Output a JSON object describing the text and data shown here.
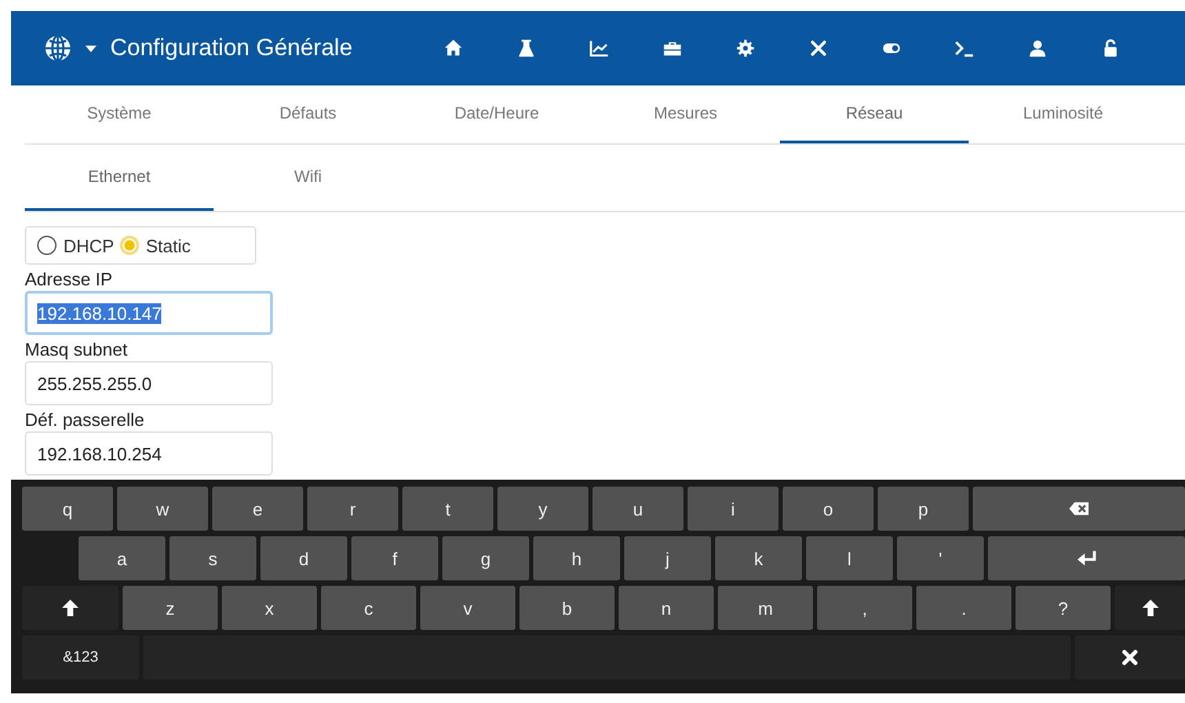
{
  "header": {
    "title": "Configuration Générale"
  },
  "tabs": [
    {
      "label": "Système",
      "selected": false
    },
    {
      "label": "Défauts",
      "selected": false
    },
    {
      "label": "Date/Heure",
      "selected": false
    },
    {
      "label": "Mesures",
      "selected": false
    },
    {
      "label": "Réseau",
      "selected": true
    },
    {
      "label": "Luminosité",
      "selected": false
    }
  ],
  "subtabs": [
    {
      "label": "Ethernet",
      "selected": true
    },
    {
      "label": "Wifi",
      "selected": false
    }
  ],
  "mode": [
    {
      "label": "DHCP",
      "selected": false
    },
    {
      "label": "Static",
      "selected": true
    }
  ],
  "fields": [
    {
      "label": "Adresse IP",
      "value": "192.168.10.147",
      "focused": true
    },
    {
      "label": "Masq subnet",
      "value": "255.255.255.0",
      "focused": false
    },
    {
      "label": "Déf. passerelle",
      "value": "192.168.10.254",
      "focused": false
    }
  ],
  "keyboard": [
    [
      {
        "kind": "char",
        "label": "q"
      },
      {
        "kind": "char",
        "label": "w"
      },
      {
        "kind": "char",
        "label": "e"
      },
      {
        "kind": "char",
        "label": "r"
      },
      {
        "kind": "char",
        "label": "t"
      },
      {
        "kind": "char",
        "label": "y"
      },
      {
        "kind": "char",
        "label": "u"
      },
      {
        "kind": "char",
        "label": "i"
      },
      {
        "kind": "char",
        "label": "o"
      },
      {
        "kind": "char",
        "label": "p"
      },
      {
        "kind": "backspace"
      }
    ],
    [
      {
        "kind": "char",
        "label": "a"
      },
      {
        "kind": "char",
        "label": "s"
      },
      {
        "kind": "char",
        "label": "d"
      },
      {
        "kind": "char",
        "label": "f"
      },
      {
        "kind": "char",
        "label": "g"
      },
      {
        "kind": "char",
        "label": "h"
      },
      {
        "kind": "char",
        "label": "j"
      },
      {
        "kind": "char",
        "label": "k"
      },
      {
        "kind": "char",
        "label": "l"
      },
      {
        "kind": "char",
        "label": "'"
      },
      {
        "kind": "enter"
      }
    ],
    [
      {
        "kind": "shift"
      },
      {
        "kind": "char",
        "label": "z"
      },
      {
        "kind": "char",
        "label": "x"
      },
      {
        "kind": "char",
        "label": "c"
      },
      {
        "kind": "char",
        "label": "v"
      },
      {
        "kind": "char",
        "label": "b"
      },
      {
        "kind": "char",
        "label": "n"
      },
      {
        "kind": "char",
        "label": "m"
      },
      {
        "kind": "char",
        "label": ","
      },
      {
        "kind": "char",
        "label": "."
      },
      {
        "kind": "char",
        "label": "?"
      },
      {
        "kind": "shift"
      }
    ],
    [
      {
        "kind": "mode",
        "label": "&123"
      },
      {
        "kind": "space"
      },
      {
        "kind": "close"
      }
    ]
  ]
}
